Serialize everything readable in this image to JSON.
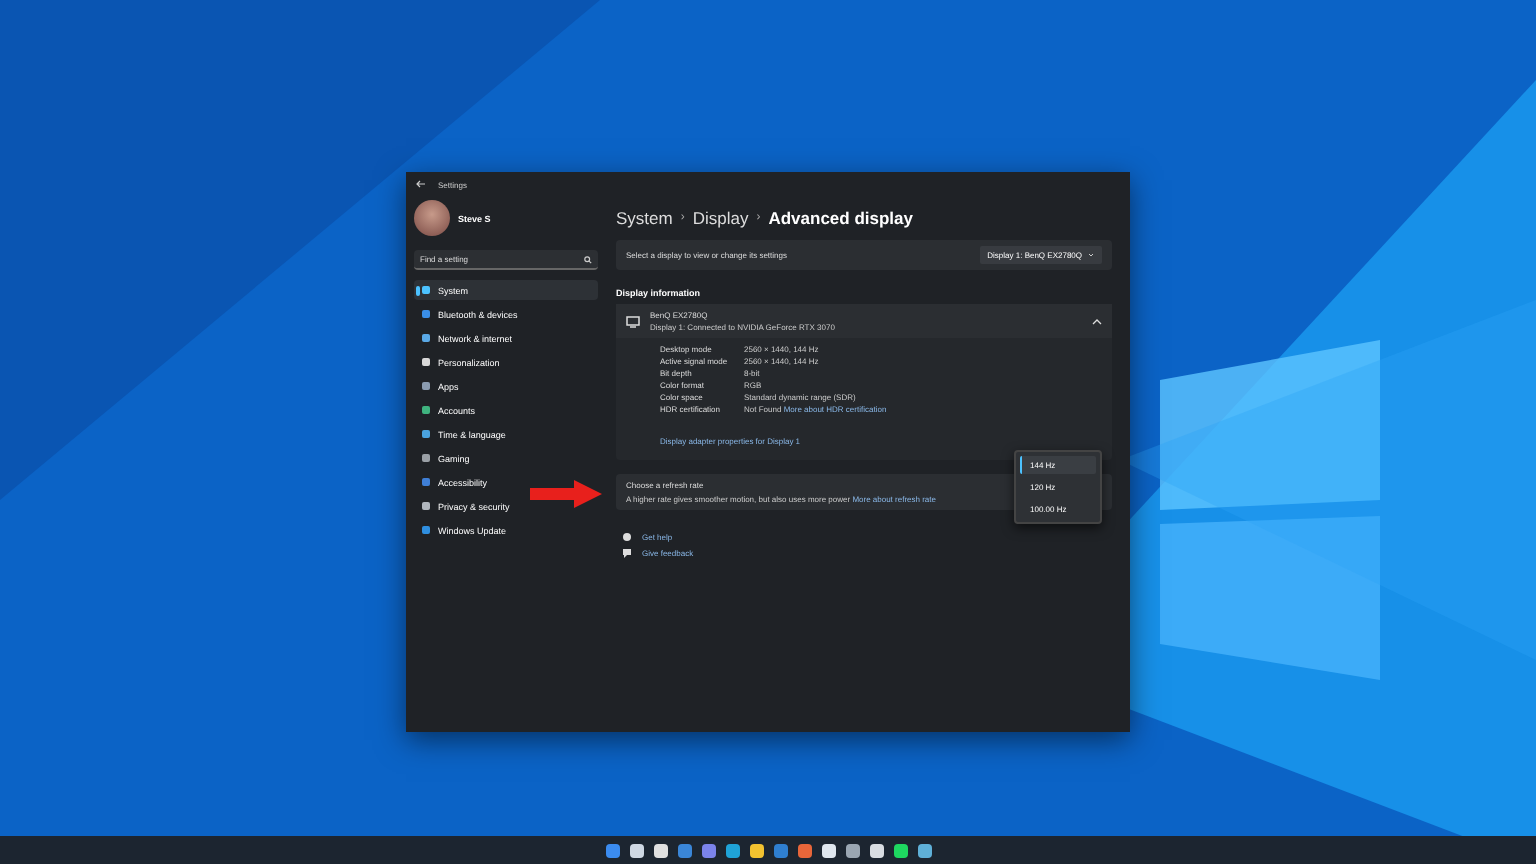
{
  "window": {
    "title": "Settings"
  },
  "user": {
    "name": "Steve S"
  },
  "search": {
    "placeholder": "Find a setting"
  },
  "nav": [
    {
      "label": "System",
      "selected": true,
      "color": "#4cc2ff"
    },
    {
      "label": "Bluetooth & devices",
      "selected": false,
      "color": "#3a8ee6"
    },
    {
      "label": "Network & internet",
      "selected": false,
      "color": "#5aa9e6"
    },
    {
      "label": "Personalization",
      "selected": false,
      "color": "#d8d8d8"
    },
    {
      "label": "Apps",
      "selected": false,
      "color": "#8a9bb0"
    },
    {
      "label": "Accounts",
      "selected": false,
      "color": "#3fb37f"
    },
    {
      "label": "Time & language",
      "selected": false,
      "color": "#4aa3df"
    },
    {
      "label": "Gaming",
      "selected": false,
      "color": "#9aa0a6"
    },
    {
      "label": "Accessibility",
      "selected": false,
      "color": "#3f7fd6"
    },
    {
      "label": "Privacy & security",
      "selected": false,
      "color": "#b0b6bd"
    },
    {
      "label": "Windows Update",
      "selected": false,
      "color": "#2f8fe0"
    }
  ],
  "breadcrumb": [
    "System",
    "Display",
    "Advanced display"
  ],
  "breadcrumb_separator": "›",
  "select_display": {
    "label": "Select a display to view or change its settings",
    "value": "Display 1: BenQ EX2780Q"
  },
  "section_title": "Display information",
  "display": {
    "name": "BenQ EX2780Q",
    "subtitle": "Display 1: Connected to NVIDIA GeForce RTX 3070",
    "expanded": true,
    "rows": [
      {
        "label": "Desktop mode",
        "value": "2560 × 1440, 144 Hz"
      },
      {
        "label": "Active signal mode",
        "value": "2560 × 1440, 144 Hz"
      },
      {
        "label": "Bit depth",
        "value": "8-bit"
      },
      {
        "label": "Color format",
        "value": "RGB"
      },
      {
        "label": "Color space",
        "value": "Standard dynamic range (SDR)"
      },
      {
        "label": "HDR certification",
        "value": "Not Found",
        "link": "More about HDR certification"
      }
    ],
    "link": "Display adapter properties for Display 1"
  },
  "refresh": {
    "title": "Choose a refresh rate",
    "description": "A higher rate gives smoother motion, but also uses more power",
    "link": "More about refresh rate",
    "options": [
      {
        "label": "144 Hz",
        "selected": true
      },
      {
        "label": "120 Hz",
        "selected": false
      },
      {
        "label": "100.00 Hz",
        "selected": false
      }
    ]
  },
  "help": [
    {
      "kind": "help",
      "label": "Get help"
    },
    {
      "kind": "feedback",
      "label": "Give feedback"
    }
  ],
  "taskbar": [
    {
      "color": "#3b8cf0"
    },
    {
      "color": "#cfd8e3"
    },
    {
      "color": "#e0e0e0"
    },
    {
      "color": "#3a86d8"
    },
    {
      "color": "#7b83eb"
    },
    {
      "color": "#1fa3d8"
    },
    {
      "color": "#f2c230"
    },
    {
      "color": "#2f7fd0"
    },
    {
      "color": "#e8663a"
    },
    {
      "color": "#dfe6ee"
    },
    {
      "color": "#9aa6b2"
    },
    {
      "color": "#d9dde2"
    },
    {
      "color": "#1ed760"
    },
    {
      "color": "#5fb0d8"
    }
  ]
}
